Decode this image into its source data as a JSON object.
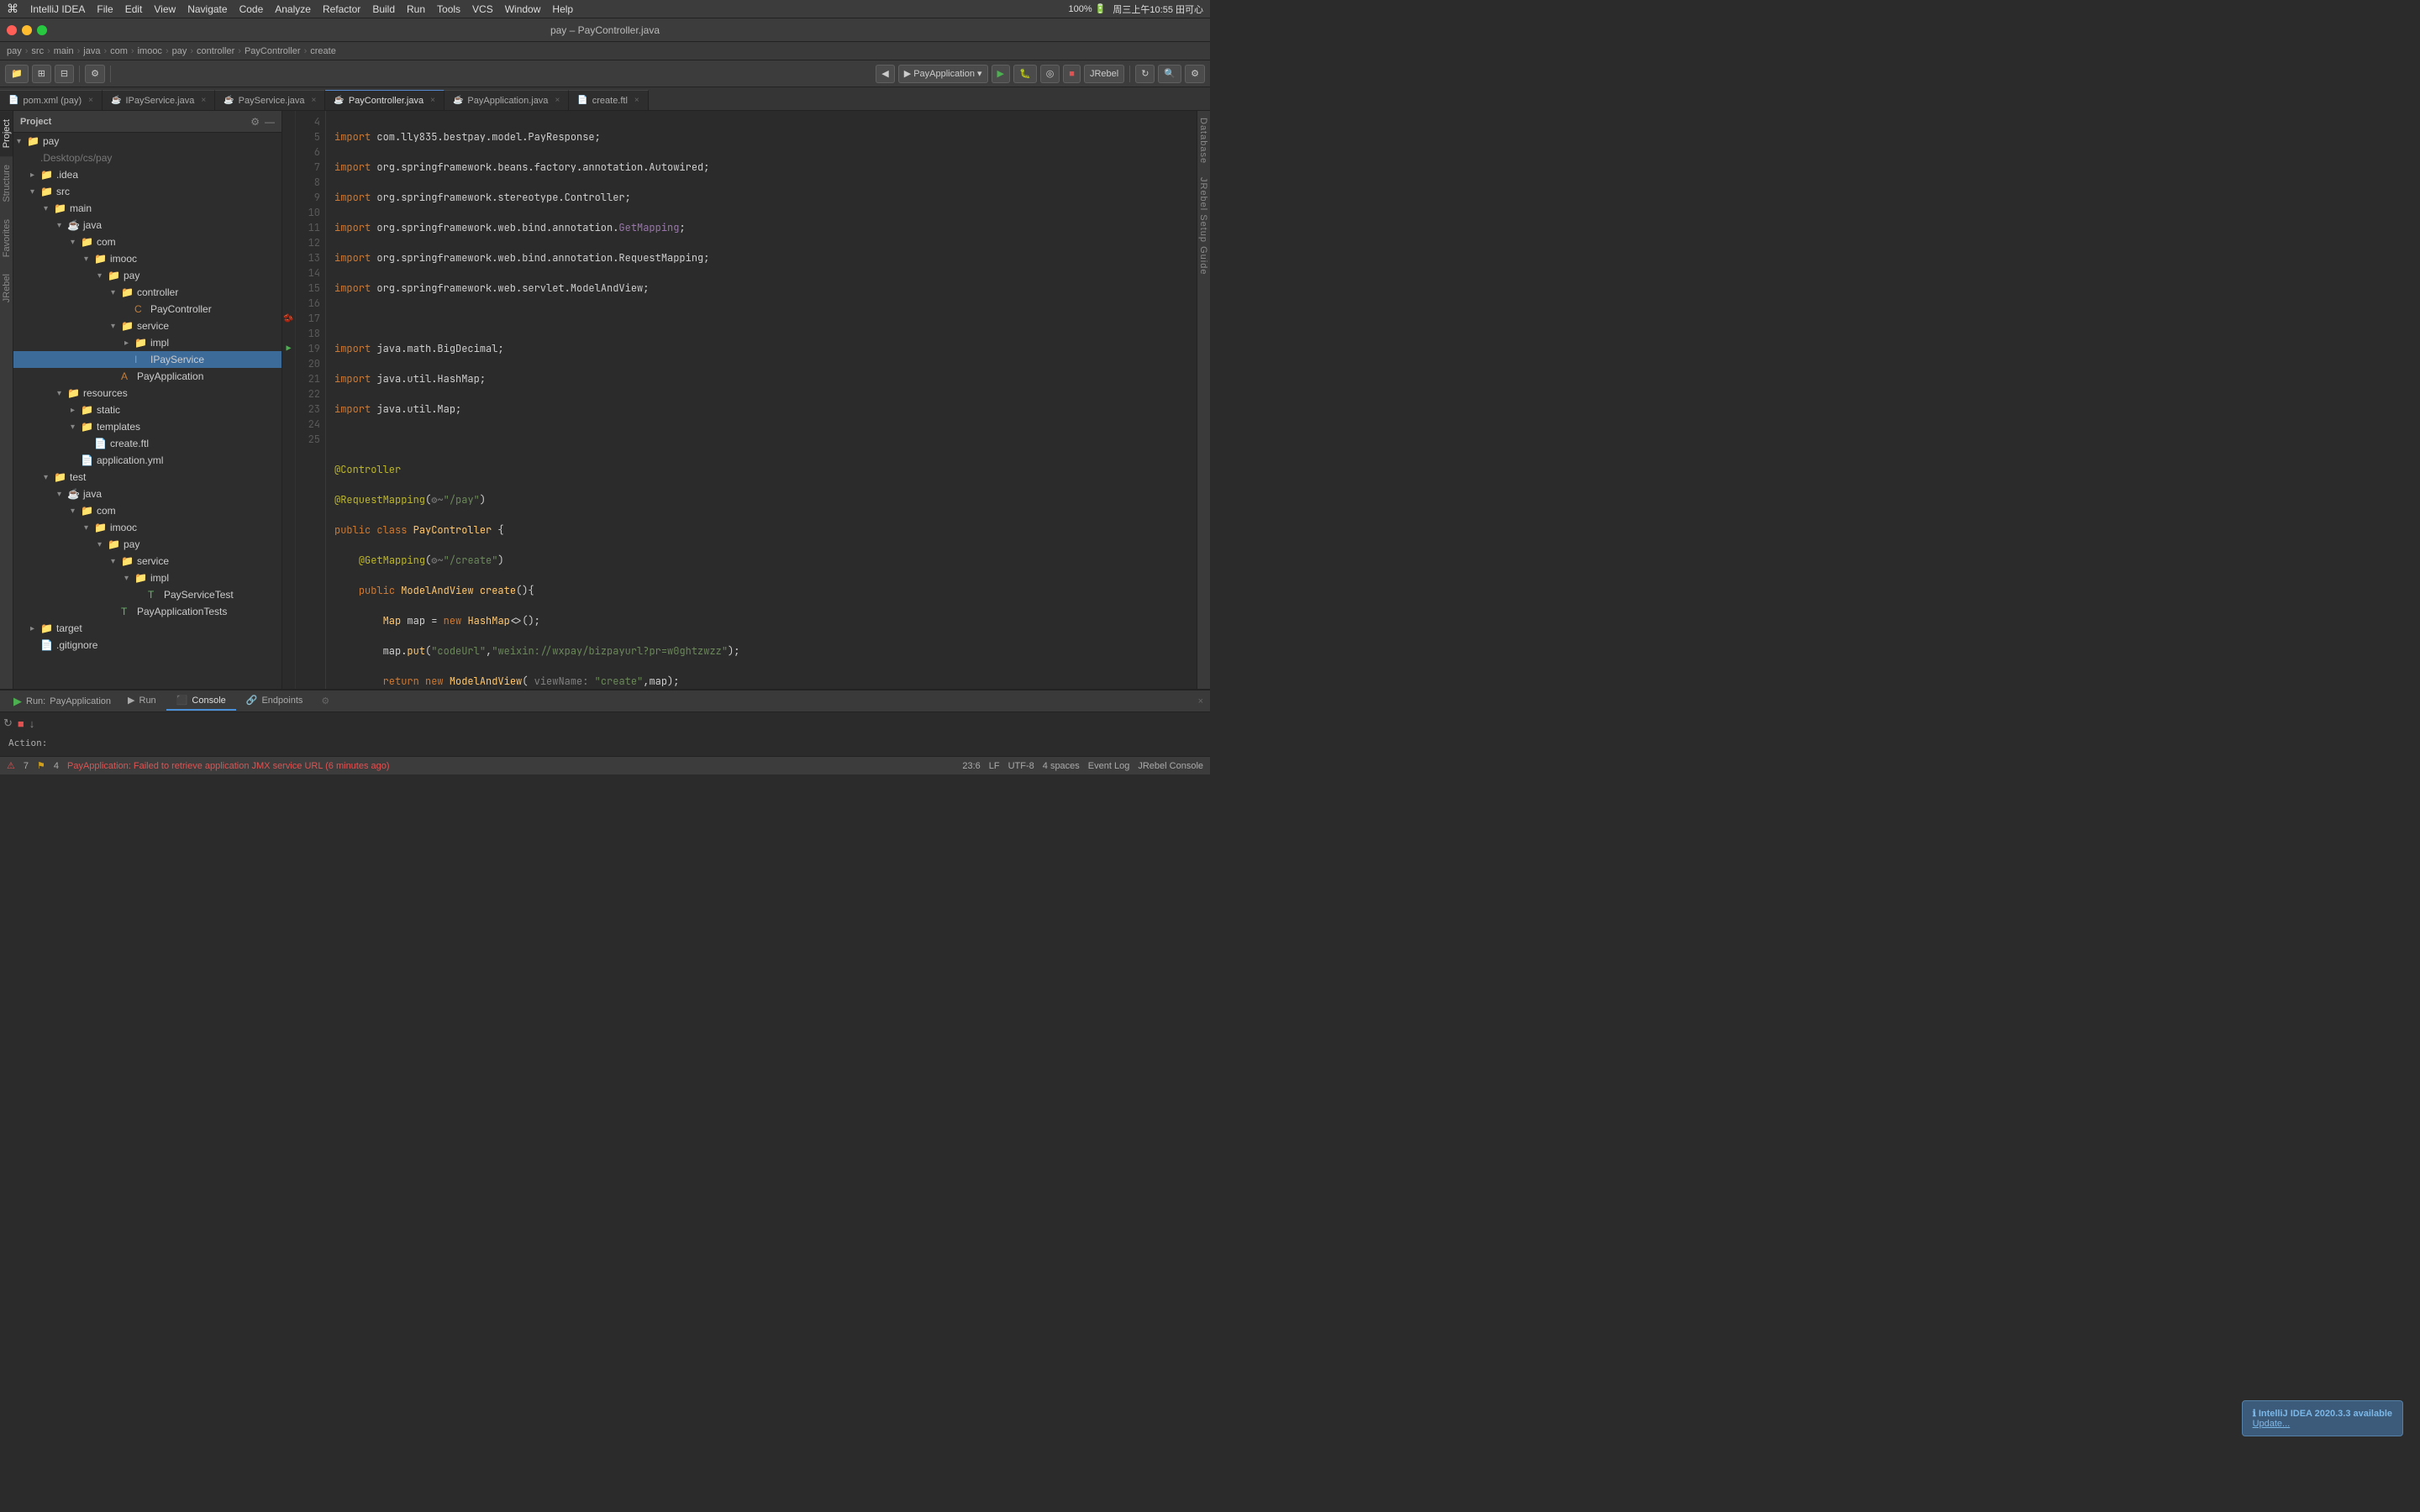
{
  "menubar": {
    "apple": "⌘",
    "items": [
      "IntelliJ IDEA",
      "File",
      "Edit",
      "View",
      "Navigate",
      "Code",
      "Analyze",
      "Refactor",
      "Build",
      "Run",
      "Tools",
      "VCS",
      "Window",
      "Help"
    ],
    "right": "周三上午10:55  田可心"
  },
  "titlebar": {
    "title": "pay – PayController.java"
  },
  "breadcrumb": {
    "items": [
      "pay",
      "src",
      "main",
      "java",
      "com",
      "imooc",
      "pay",
      "controller",
      "PayController",
      "create"
    ]
  },
  "tabs": [
    {
      "label": "pom.xml (pay)",
      "icon": "📄",
      "active": false,
      "closable": true
    },
    {
      "label": "IPayService.java",
      "icon": "☕",
      "active": false,
      "closable": true
    },
    {
      "label": "PayService.java",
      "icon": "☕",
      "active": false,
      "closable": true
    },
    {
      "label": "PayController.java",
      "icon": "☕",
      "active": true,
      "closable": true
    },
    {
      "label": "PayApplication.java",
      "icon": "☕",
      "active": false,
      "closable": true
    },
    {
      "label": "create.ftl",
      "icon": "📄",
      "active": false,
      "closable": true
    }
  ],
  "project": {
    "title": "Project",
    "tree": [
      {
        "level": 0,
        "label": "pay",
        "type": "folder",
        "expanded": true
      },
      {
        "level": 1,
        "label": ".Desktop/cs/pay",
        "type": "path",
        "expanded": false
      },
      {
        "level": 1,
        "label": ".idea",
        "type": "folder",
        "expanded": false
      },
      {
        "level": 1,
        "label": "src",
        "type": "folder",
        "expanded": true
      },
      {
        "level": 2,
        "label": "main",
        "type": "folder",
        "expanded": true
      },
      {
        "level": 3,
        "label": "java",
        "type": "folder",
        "expanded": true
      },
      {
        "level": 4,
        "label": "com",
        "type": "folder",
        "expanded": true
      },
      {
        "level": 5,
        "label": "imooc",
        "type": "folder",
        "expanded": true
      },
      {
        "level": 6,
        "label": "pay",
        "type": "folder",
        "expanded": true
      },
      {
        "level": 7,
        "label": "controller",
        "type": "folder",
        "expanded": true
      },
      {
        "level": 8,
        "label": "PayController",
        "type": "class",
        "selected": false
      },
      {
        "level": 7,
        "label": "service",
        "type": "folder",
        "expanded": true
      },
      {
        "level": 8,
        "label": "impl",
        "type": "folder",
        "expanded": false
      },
      {
        "level": 8,
        "label": "IPayService",
        "type": "interface",
        "selected": true
      },
      {
        "level": 7,
        "label": "PayApplication",
        "type": "class"
      },
      {
        "level": 6,
        "label": "resources",
        "type": "folder",
        "expanded": true
      },
      {
        "level": 7,
        "label": "static",
        "type": "folder",
        "expanded": false
      },
      {
        "level": 7,
        "label": "templates",
        "type": "folder",
        "expanded": true
      },
      {
        "level": 8,
        "label": "create.ftl",
        "type": "ftl"
      },
      {
        "level": 7,
        "label": "application.yml",
        "type": "yaml"
      },
      {
        "level": 2,
        "label": "test",
        "type": "folder",
        "expanded": true
      },
      {
        "level": 3,
        "label": "java",
        "type": "folder",
        "expanded": true
      },
      {
        "level": 4,
        "label": "com",
        "type": "folder",
        "expanded": true
      },
      {
        "level": 5,
        "label": "imooc",
        "type": "folder",
        "expanded": true
      },
      {
        "level": 6,
        "label": "pay",
        "type": "folder",
        "expanded": true
      },
      {
        "level": 7,
        "label": "service",
        "type": "folder",
        "expanded": true
      },
      {
        "level": 8,
        "label": "impl",
        "type": "folder",
        "expanded": true
      },
      {
        "level": 9,
        "label": "PayServiceTest",
        "type": "test"
      },
      {
        "level": 6,
        "label": "PayApplicationTests",
        "type": "test"
      },
      {
        "level": 1,
        "label": "target",
        "type": "folder",
        "expanded": false
      },
      {
        "level": 1,
        "label": ".gitignore",
        "type": "file"
      }
    ]
  },
  "code": {
    "lines": [
      {
        "num": 4,
        "text": "import com.lly835.bestpay.model.PayResponse;",
        "style": "import"
      },
      {
        "num": 5,
        "text": "import org.springframework.beans.factory.annotation.Autowired;",
        "style": "import"
      },
      {
        "num": 6,
        "text": "import org.springframework.stereotype.Controller;",
        "style": "import"
      },
      {
        "num": 7,
        "text": "import org.springframework.web.bind.annotation.GetMapping;",
        "style": "import"
      },
      {
        "num": 8,
        "text": "import org.springframework.web.bind.annotation.RequestMapping;",
        "style": "import"
      },
      {
        "num": 9,
        "text": "import org.springframework.web.servlet.ModelAndView;",
        "style": "import"
      },
      {
        "num": 10,
        "text": "",
        "style": "normal"
      },
      {
        "num": 11,
        "text": "import java.math.BigDecimal;",
        "style": "import"
      },
      {
        "num": 12,
        "text": "import java.util.HashMap;",
        "style": "import"
      },
      {
        "num": 13,
        "text": "import java.util.Map;",
        "style": "import"
      },
      {
        "num": 14,
        "text": "",
        "style": "normal"
      },
      {
        "num": 15,
        "text": "@Controller",
        "style": "annotation"
      },
      {
        "num": 16,
        "text": "@RequestMapping(\"/pay\")",
        "style": "annotation-mapping"
      },
      {
        "num": 17,
        "text": "public class PayController {",
        "style": "class-decl"
      },
      {
        "num": 18,
        "text": "    @GetMapping(\"/create\")",
        "style": "annotation-indent"
      },
      {
        "num": 19,
        "text": "    public ModelAndView create(){",
        "style": "method-decl"
      },
      {
        "num": 20,
        "text": "        Map map = new HashMap<>();",
        "style": "code"
      },
      {
        "num": 21,
        "text": "        map.put(\"codeUrl\",\"weixin://wxpay/bizpayurl?pr=w0ghtzwzz\");",
        "style": "code"
      },
      {
        "num": 22,
        "text": "        return new ModelAndView( viewName: \"create\",map);",
        "style": "code"
      },
      {
        "num": 23,
        "text": "    }",
        "style": "code"
      },
      {
        "num": 24,
        "text": "",
        "style": "normal"
      },
      {
        "num": 25,
        "text": "}",
        "style": "code"
      }
    ]
  },
  "run": {
    "label": "Run:",
    "app": "PayApplication",
    "tabs": [
      "Run",
      "Console",
      "Endpoints"
    ],
    "active_tab": "Console",
    "status_text": "Action:",
    "error_text": "PayApplication: Failed to retrieve application JMX service URL (6 minutes ago)"
  },
  "statusbar": {
    "error_count": "⚠ 7",
    "warning_count": "4",
    "position": "23:6",
    "encoding": "UTF-8",
    "indent": "4 spaces",
    "line_separator": "LF",
    "event_log": "Event Log",
    "jrebel": "JRebel Console"
  },
  "notification": {
    "title": "ℹ IntelliJ IDEA 2020.3.3 available",
    "link": "Update..."
  },
  "toolbar": {
    "run_config": "PayApplication",
    "jrebel": "JRebel"
  }
}
